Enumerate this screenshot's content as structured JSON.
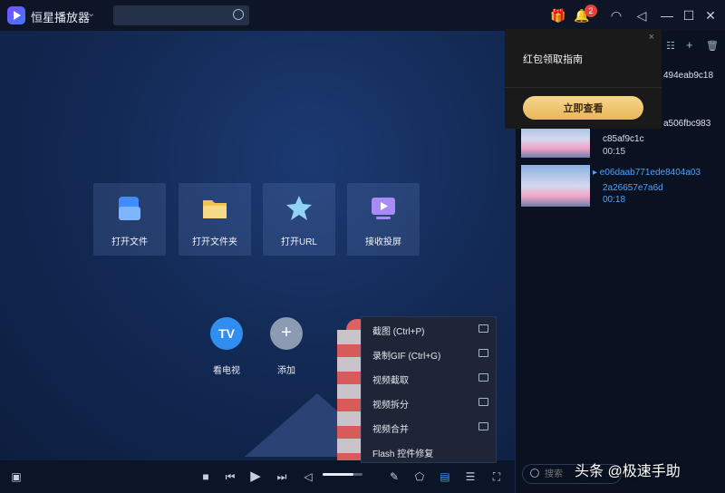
{
  "title_bar": {
    "app_name": "恒星播放器",
    "app_menu_caret": "⌄",
    "search_value": "",
    "icons": [
      "gift-icon",
      "bell-icon",
      "headset-icon",
      "speaker-icon",
      "minimize-icon",
      "maximize-icon",
      "close-icon"
    ],
    "notification_count": "2"
  },
  "home": {
    "tiles": [
      {
        "label": "打开文件",
        "icon": "file-icon",
        "color": "#3f8cff"
      },
      {
        "label": "打开文件夹",
        "icon": "folder-icon",
        "color": "#f3c24d"
      },
      {
        "label": "打开URL",
        "icon": "url-star-icon",
        "color": "#7cc7f0"
      },
      {
        "label": "接收投屏",
        "icon": "cast-screen-icon",
        "color": "#9a7cf0"
      }
    ],
    "round_buttons": [
      {
        "label": "看电视",
        "glyph": "TV",
        "color": "#2f8ef0"
      },
      {
        "label": "添加",
        "glyph": "+",
        "color": "#8c9ab2"
      }
    ]
  },
  "context_menu": {
    "items": [
      "截图 (Ctrl+P)",
      "录制GIF (Ctrl+G)",
      "视频截取",
      "视频拆分",
      "视频合并",
      "Flash 控件修复"
    ]
  },
  "notification_popup": {
    "title": "红包领取指南",
    "button": "立即查看",
    "close": "×"
  },
  "playlist": {
    "items": [
      {
        "name_line1": "494eab9c18",
        "name_line2": "",
        "duration": ""
      },
      {
        "name_line1": "a506fbc983",
        "name_line2": "c85af9c1c",
        "duration": "00:15"
      },
      {
        "name_line1": "▸ e06daab771ede8404a03",
        "name_line2": "2a26657e7a6d",
        "duration": "00:18"
      }
    ],
    "search_placeholder": "搜索"
  },
  "watermark": "头条 @极速手助"
}
